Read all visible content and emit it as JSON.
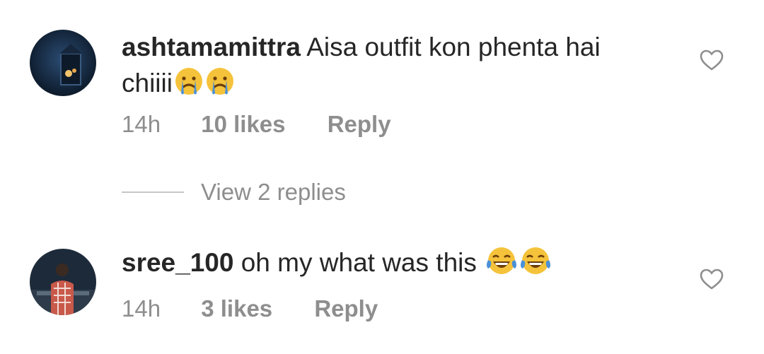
{
  "comments": [
    {
      "username": "ashtamamittra",
      "text_line1": "Aisa outfit kon phenta hai",
      "text_line2": "chiiii",
      "emojis": [
        "crying-face",
        "crying-face"
      ],
      "time": "14h",
      "likes": "10 likes",
      "reply": "Reply",
      "view_replies": "View 2 replies"
    },
    {
      "username": "sree_100",
      "text_line1": "oh my what was this",
      "emojis": [
        "tears-of-joy-face",
        "tears-of-joy-face"
      ],
      "time": "14h",
      "likes": "3 likes",
      "reply": "Reply"
    }
  ],
  "colors": {
    "text": "#262626",
    "meta": "#8e8e8e",
    "divider": "#c7c7c7",
    "emoji_face": "#f5c33b",
    "emoji_tear": "#4a90d9"
  }
}
